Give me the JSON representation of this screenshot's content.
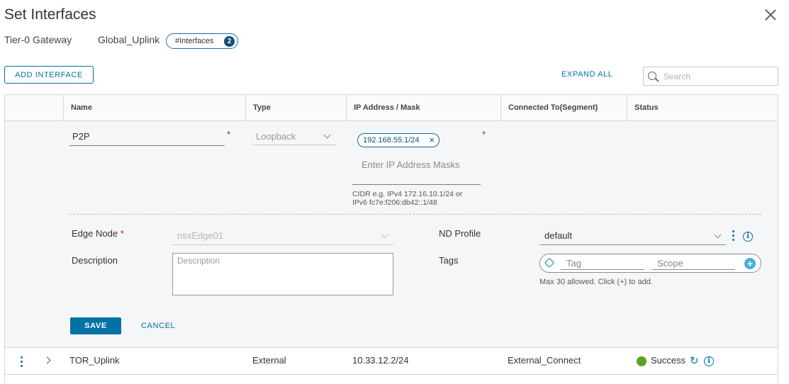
{
  "dialog": {
    "title": "Set Interfaces",
    "gateway_type": "Tier-0 Gateway",
    "gateway_name": "Global_Uplink",
    "interfaces_label": "#Interfaces",
    "interfaces_count": "2"
  },
  "toolbar": {
    "add_interface": "ADD INTERFACE",
    "expand_all": "EXPAND ALL",
    "search_placeholder": "Search"
  },
  "table": {
    "columns": [
      "Name",
      "Type",
      "IP Address / Mask",
      "Connected To(Segment)",
      "Status"
    ]
  },
  "edit_row": {
    "name": "P2P",
    "type": "Loopback",
    "ip_tag": "192.168.55.1/24",
    "ip_placeholder": "Enter IP Address Masks",
    "cidr_hint_1": "CIDR e.g. IPv4 172.16.10.1/24 or",
    "cidr_hint_2": "IPv6 fc7e:f206:db42::1/48",
    "edge_node_label": "Edge Node",
    "edge_node_value": "nsxEdge01",
    "description_label": "Description",
    "description_placeholder": "Description",
    "nd_profile_label": "ND Profile",
    "nd_profile_value": "default",
    "tags_label": "Tags",
    "tag_placeholder": "Tag",
    "scope_placeholder": "Scope",
    "tags_hint": "Max 30 allowed. Click (+) to add.",
    "save": "SAVE",
    "cancel": "CANCEL",
    "required_mark": "*"
  },
  "rows": [
    {
      "name": "TOR_Uplink",
      "type": "External",
      "ip": "10.33.12.2/24",
      "segment": "External_Connect",
      "status": "Success"
    }
  ],
  "colors": {
    "accent": "#0072a3",
    "success": "#5aa220",
    "required": "#c92100"
  }
}
